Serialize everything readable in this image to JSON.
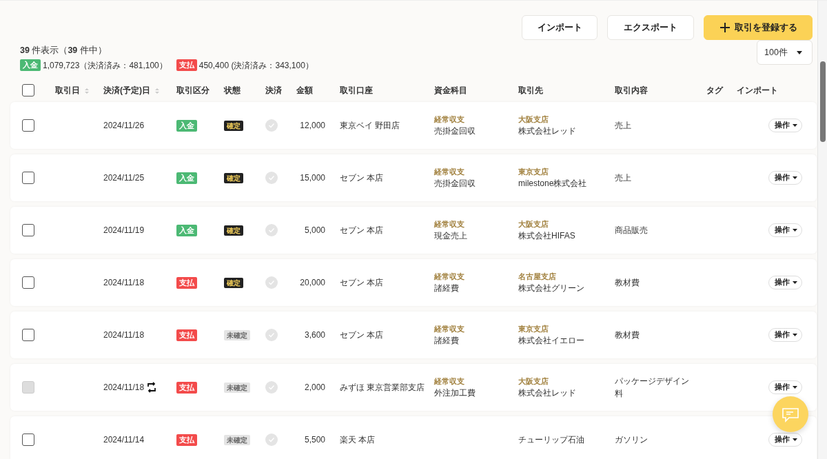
{
  "actions": [
    "インポート",
    "エクスポート",
    "取引を登録する"
  ],
  "summary": {
    "count": "**39** 件表示（**39** 件中）",
    "items": [
      {
        "kind": "income",
        "label": "入金",
        "text": "1,079,723（決済済み：481,100）"
      },
      {
        "kind": "expense",
        "label": "支払",
        "text": "450,400 (決済済み：343,100）"
      }
    ]
  },
  "per_page": "100件",
  "header_checkbox": {
    "checked": false
  },
  "columns": [
    {
      "label": "取引日",
      "sortable": true
    },
    {
      "label": "決済(予定)日",
      "sortable": true
    },
    {
      "label": "取引区分",
      "sortable": false
    },
    {
      "label": "状態",
      "sortable": false
    },
    {
      "label": "決済",
      "sortable": false
    },
    {
      "label": "金額",
      "sortable": false
    },
    {
      "label": "取引口座",
      "sortable": false
    },
    {
      "label": "資金科目",
      "sortable": false
    },
    {
      "label": "取引先",
      "sortable": false
    },
    {
      "label": "取引内容",
      "sortable": false
    },
    {
      "label": "タグ",
      "sortable": false
    },
    {
      "label": "インポート",
      "sortable": false
    }
  ],
  "rows": [
    {
      "selected": false,
      "disabled": false,
      "date": "2024/11/26",
      "recurring": false,
      "kind": "income",
      "type_label": "入金",
      "confirmed": true,
      "status": "確定",
      "amount": "12,000",
      "account": "東京ベイ 野田店",
      "category_group": "経常収支",
      "category": "売掛金回収",
      "partner_branch": "大阪支店",
      "partner": "株式会社レッド",
      "description": "売上",
      "menu": "操作"
    },
    {
      "selected": false,
      "disabled": false,
      "date": "2024/11/25",
      "recurring": false,
      "kind": "income",
      "type_label": "入金",
      "confirmed": true,
      "status": "確定",
      "amount": "15,000",
      "account": "セブン 本店",
      "category_group": "経常収支",
      "category": "売掛金回収",
      "partner_branch": "東京支店",
      "partner": "milestone株式会社",
      "description": "売上",
      "menu": "操作"
    },
    {
      "selected": false,
      "disabled": false,
      "date": "2024/11/19",
      "recurring": false,
      "kind": "income",
      "type_label": "入金",
      "confirmed": true,
      "status": "確定",
      "amount": "5,000",
      "account": "セブン 本店",
      "category_group": "経常収支",
      "category": "現金売上",
      "partner_branch": "大阪支店",
      "partner": "株式会社HIFAS",
      "description": "商品販売",
      "menu": "操作"
    },
    {
      "selected": false,
      "disabled": false,
      "date": "2024/11/18",
      "recurring": false,
      "kind": "expense",
      "type_label": "支払",
      "confirmed": true,
      "status": "確定",
      "amount": "20,000",
      "account": "セブン 本店",
      "category_group": "経常収支",
      "category": "諸経費",
      "partner_branch": "名古屋支店",
      "partner": "株式会社グリーン",
      "description": "教材費",
      "menu": "操作"
    },
    {
      "selected": false,
      "disabled": false,
      "date": "2024/11/18",
      "recurring": false,
      "kind": "expense",
      "type_label": "支払",
      "confirmed": false,
      "status": "未確定",
      "amount": "3,600",
      "account": "セブン 本店",
      "category_group": "経常収支",
      "category": "諸経費",
      "partner_branch": "東京支店",
      "partner": "株式会社イエロー",
      "description": "教材費",
      "menu": "操作"
    },
    {
      "selected": false,
      "disabled": true,
      "date": "2024/11/18",
      "recurring": true,
      "kind": "expense",
      "type_label": "支払",
      "confirmed": false,
      "status": "未確定",
      "amount": "2,000",
      "account": "みずほ 東京営業部支店",
      "category_group": "経常収支",
      "category": "外注加工費",
      "partner_branch": "大阪支店",
      "partner": "株式会社レッド",
      "description": "パッケージデザイン料",
      "menu": "操作"
    },
    {
      "selected": false,
      "disabled": false,
      "date": "2024/11/14",
      "recurring": false,
      "kind": "expense",
      "type_label": "支払",
      "confirmed": false,
      "status": "未確定",
      "amount": "5,500",
      "account": "楽天 本店",
      "partner": "チューリップ石油",
      "description": "ガソリン",
      "menu": "操作"
    }
  ]
}
